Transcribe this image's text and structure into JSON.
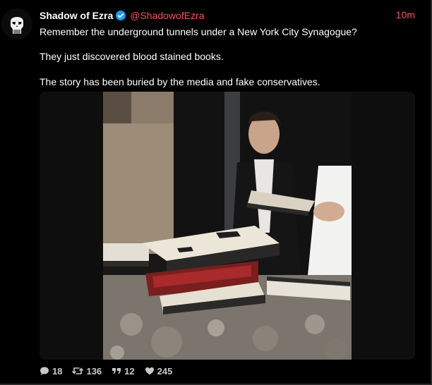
{
  "post": {
    "author": {
      "display_name": "Shadow of Ezra",
      "handle": "@ShadowofEzra",
      "verified": true
    },
    "timestamp": "10m",
    "text_lines": [
      "Remember the underground tunnels under a New York City Synagogue?",
      "They just discovered blood stained books.",
      "The story has been buried by the media and fake conservatives."
    ],
    "media": {
      "kind": "photo"
    },
    "actions": {
      "replies": "18",
      "reposts": "136",
      "quotes": "12",
      "likes": "245"
    }
  },
  "colors": {
    "background": "#000000",
    "accent_red": "#f05a5a",
    "verified_blue": "#1d9bf0",
    "action_gray": "#c8c8c8"
  },
  "icons": [
    "avatar-skull",
    "verified-badge-icon",
    "reply-icon",
    "repost-icon",
    "quote-icon",
    "like-icon"
  ]
}
